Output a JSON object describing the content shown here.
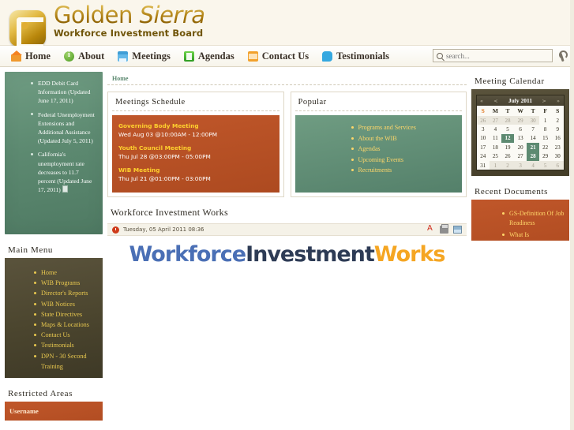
{
  "site": {
    "logo_title_1": "Golden",
    "logo_title_2": "Sierra",
    "logo_subtitle": "Workforce Investment Board"
  },
  "nav": {
    "items": [
      {
        "label": "Home",
        "icon": "home-icon"
      },
      {
        "label": "About",
        "icon": "info-icon"
      },
      {
        "label": "Meetings",
        "icon": "calendar-icon"
      },
      {
        "label": "Agendas",
        "icon": "chart-icon"
      },
      {
        "label": "Contact Us",
        "icon": "envelope-icon"
      },
      {
        "label": "Testimonials",
        "icon": "speech-bubble-icon"
      }
    ],
    "search_placeholder": "search...",
    "search_value": ""
  },
  "news": {
    "items": [
      "EDD Debit Card Information (Updated June 17, 2011)",
      "Federal Unemployment Extensions and Additional Assistance (Updated July 5, 2011)",
      "California's unemployment rate decreases to 11.7 percent (Updated June 17, 2011)"
    ]
  },
  "main_menu": {
    "title": "Main Menu",
    "items": [
      "Home",
      "WIB Programs",
      "Director's Reports",
      "WIB Notices",
      "State Directives",
      "Maps & Locations",
      "Contact Us",
      "Testimonials",
      "DPN - 30 Second Training"
    ]
  },
  "restricted": {
    "title": "Restricted Areas",
    "username_label": "Username",
    "username_value": ""
  },
  "content": {
    "breadcrumb": "Home",
    "meetings": {
      "title": "Meetings Schedule",
      "items": [
        {
          "name": "Governing Body Meeting",
          "time": "Wed Aug 03 @10:00AM - 12:00PM"
        },
        {
          "name": "Youth Council Meeting",
          "time": "Thu Jul 28 @03:00PM - 05:00PM"
        },
        {
          "name": "WIB Meeting",
          "time": "Thu Jul 21 @01:00PM - 03:00PM"
        }
      ]
    },
    "popular": {
      "title": "Popular",
      "items": [
        "Programs and Services",
        "About the WIB",
        "Agendas",
        "Upcoming Events",
        "Recruitments"
      ]
    },
    "article": {
      "title": "Workforce Investment Works",
      "date": "Tuesday, 05 April 2011 08:36",
      "icons": [
        "pdf-icon",
        "print-icon",
        "email-icon"
      ],
      "banner_1": "Workforce",
      "banner_2": "Investment",
      "banner_3": "Works"
    }
  },
  "calendar": {
    "title": "Meeting Calendar",
    "prev_first": "«",
    "prev": "<",
    "month": "July 2011",
    "next": ">",
    "next_last": "»",
    "weekdays": [
      "S",
      "M",
      "T",
      "W",
      "T",
      "F",
      "S"
    ],
    "weeks": [
      [
        {
          "d": "26",
          "out": true
        },
        {
          "d": "27",
          "out": true
        },
        {
          "d": "28",
          "out": true
        },
        {
          "d": "29",
          "out": true
        },
        {
          "d": "30",
          "out": true
        },
        {
          "d": "1"
        },
        {
          "d": "2"
        }
      ],
      [
        {
          "d": "3"
        },
        {
          "d": "4"
        },
        {
          "d": "5"
        },
        {
          "d": "6"
        },
        {
          "d": "7"
        },
        {
          "d": "8"
        },
        {
          "d": "9"
        }
      ],
      [
        {
          "d": "10"
        },
        {
          "d": "11"
        },
        {
          "d": "12",
          "hl": true
        },
        {
          "d": "13"
        },
        {
          "d": "14"
        },
        {
          "d": "15"
        },
        {
          "d": "16"
        }
      ],
      [
        {
          "d": "17"
        },
        {
          "d": "18"
        },
        {
          "d": "19"
        },
        {
          "d": "20"
        },
        {
          "d": "21",
          "hl": true
        },
        {
          "d": "22"
        },
        {
          "d": "23"
        }
      ],
      [
        {
          "d": "24"
        },
        {
          "d": "25"
        },
        {
          "d": "26"
        },
        {
          "d": "27"
        },
        {
          "d": "28",
          "hl": true
        },
        {
          "d": "29"
        },
        {
          "d": "30"
        }
      ],
      [
        {
          "d": "31"
        },
        {
          "d": "1",
          "out": true
        },
        {
          "d": "2",
          "out": true
        },
        {
          "d": "3",
          "out": true
        },
        {
          "d": "4",
          "out": true
        },
        {
          "d": "5",
          "out": true
        },
        {
          "d": "6",
          "out": true
        }
      ]
    ]
  },
  "recent_docs": {
    "title": "Recent Documents",
    "items": [
      "GS-Definition Of Job Readiness",
      "What Is"
    ]
  }
}
